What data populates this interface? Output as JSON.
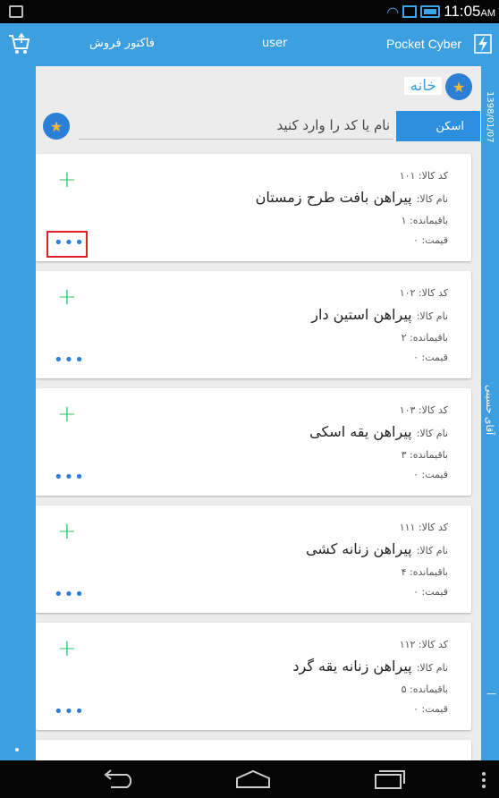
{
  "status_bar": {
    "time": "11:05",
    "ampm": "AM"
  },
  "top_bar": {
    "invoice_label": "فاکتور فروش",
    "user_label": "user",
    "app_name": "Pocket Cyber"
  },
  "right_rail": {
    "date_text": "1398/01/07",
    "name_text": "آقای حسینی",
    "marker_text": "|"
  },
  "header": {
    "home_label": "خانه"
  },
  "search": {
    "placeholder": "نام یا کد را وارد کنید",
    "scan_label": "اسکن"
  },
  "labels": {
    "code": "کد کالا:",
    "name": "نام کالا:",
    "remaining": "باقیمانده:",
    "price": "قیمت:"
  },
  "products": [
    {
      "code": "۱۰۱",
      "name": "پیراهن بافت طرح زمستان",
      "remaining": "۱",
      "price": "۰"
    },
    {
      "code": "۱۰۲",
      "name": "پیراهن استین دار",
      "remaining": "۲",
      "price": "۰"
    },
    {
      "code": "۱۰۳",
      "name": "پیراهن یقه اسکی",
      "remaining": "۳",
      "price": "۰"
    },
    {
      "code": "۱۱۱",
      "name": "پیراهن زنانه کشی",
      "remaining": "۴",
      "price": "۰"
    },
    {
      "code": "۱۱۲",
      "name": "پیراهن زنانه یقه گرد",
      "remaining": "۵",
      "price": "۰"
    }
  ],
  "icons": {
    "add": "+",
    "more": "•••",
    "star": "★"
  },
  "colors": {
    "primary": "#3b9fe0",
    "star_bg": "#2c7fd6",
    "add_green": "#2bc46a",
    "highlight_red": "#e21e2a"
  }
}
